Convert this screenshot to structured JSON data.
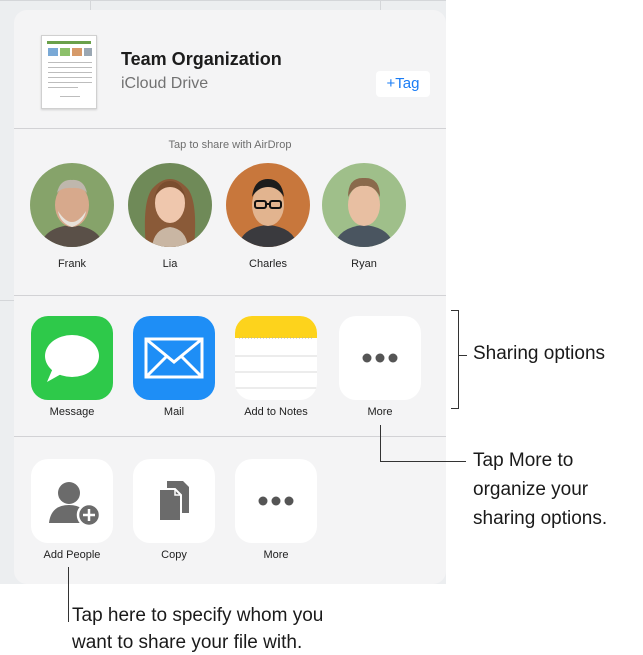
{
  "file": {
    "title": "Team Organization",
    "location": "iCloud Drive",
    "tag_label": "+Tag"
  },
  "airdrop": {
    "title": "Tap to share with AirDrop",
    "people": [
      {
        "name": "Frank"
      },
      {
        "name": "Lia"
      },
      {
        "name": "Charles"
      },
      {
        "name": "Ryan"
      }
    ]
  },
  "share_apps": [
    {
      "label": "Message",
      "icon": "message-icon"
    },
    {
      "label": "Mail",
      "icon": "mail-icon"
    },
    {
      "label": "Add to Notes",
      "icon": "notes-icon"
    },
    {
      "label": "More",
      "icon": "more-icon"
    }
  ],
  "actions": [
    {
      "label": "Add People",
      "icon": "add-person-icon"
    },
    {
      "label": "Copy",
      "icon": "copy-icon"
    },
    {
      "label": "More",
      "icon": "more-icon"
    }
  ],
  "callouts": {
    "sharing_options": "Sharing options",
    "more_line1": "Tap More to",
    "more_line2": "organize your",
    "more_line3": "sharing options.",
    "add_people_line1": "Tap here to specify whom you",
    "add_people_line2": "want to share your file with."
  },
  "colors": {
    "accent": "#1a7cf5",
    "message_green": "#2ec94a",
    "mail_blue": "#1e8ef6",
    "notes_yellow": "#fdd31c"
  }
}
